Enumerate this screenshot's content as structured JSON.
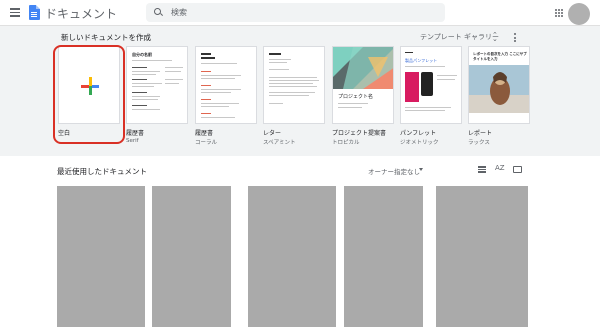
{
  "header": {
    "app_title": "ドキュメント",
    "search_placeholder": "検索"
  },
  "templates": {
    "heading": "新しいドキュメントを作成",
    "gallery_label": "テンプレート ギャラリー",
    "items": [
      {
        "name": "空白",
        "sub": ""
      },
      {
        "name": "履歴書",
        "sub": "Serif"
      },
      {
        "name": "履歴書",
        "sub": "コーラル"
      },
      {
        "name": "レター",
        "sub": "スペアミント"
      },
      {
        "name": "プロジェクト提案書",
        "sub": "トロピカル"
      },
      {
        "name": "パンフレット",
        "sub": "ジオメトリック"
      },
      {
        "name": "レポート",
        "sub": "ラックス"
      }
    ],
    "thumb_text": {
      "resume_serif": "自分の名前",
      "project": "プロジェクト名",
      "brochure": "製品パンフレット",
      "report": "レポートの目次を入力 ここにサブタイトルを入力"
    }
  },
  "recent": {
    "heading": "最近使用したドキュメント",
    "owner_filter": "オーナー指定なし",
    "sort_icon_text": "AZ"
  },
  "colors": {
    "accent_blue": "#4285f4",
    "selected_outline": "#d93025",
    "band_background": "#f1f3f4"
  },
  "icons": [
    "menu-icon",
    "docs-logo-icon",
    "search-icon",
    "apps-grid-icon",
    "unfold-more-icon",
    "more-vert-icon",
    "list-view-icon",
    "sort-icon",
    "folder-icon"
  ]
}
